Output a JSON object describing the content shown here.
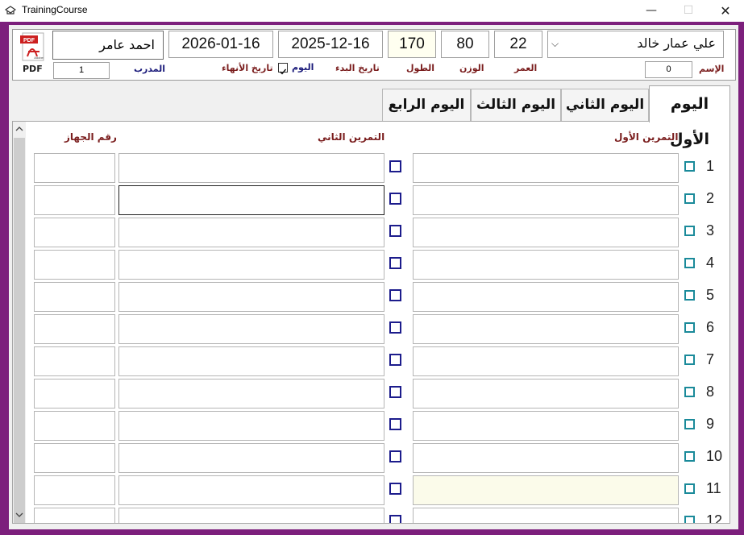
{
  "window": {
    "title": "TrainingCourse",
    "min": "—",
    "max": "☐",
    "close": "✕"
  },
  "header": {
    "name_value": "علي عمار خالد",
    "name_label": "الإسم",
    "id_value": "0",
    "age_value": "22",
    "age_label": "العمر",
    "weight_value": "80",
    "weight_label": "الوزن",
    "height_value": "170",
    "height_label": "الطول",
    "start_date_value": "2025-12-16",
    "start_date_label": "تاريخ البدء",
    "end_date_value": "2026-01-16",
    "end_date_label": "تاريخ الأنهاء",
    "today_label": "اليوم",
    "trainer_value": "احمد عامر",
    "trainer_id_value": "1",
    "trainer_label": "المدرب",
    "pdf_label": "PDF",
    "pdf_icon_text": "PDF",
    "pdf_icon_sub": "Adobe"
  },
  "tabs": [
    "اليوم الأول",
    "اليوم الثاني",
    "اليوم الثالث",
    "اليوم الرابع"
  ],
  "columns": {
    "exercise1": "التمرين الأول",
    "exercise2": "التمرين الثاني",
    "device": "رقم الجهاز"
  },
  "rows": [
    "1",
    "2",
    "3",
    "4",
    "5",
    "6",
    "7",
    "8",
    "9",
    "10",
    "11",
    "12"
  ]
}
